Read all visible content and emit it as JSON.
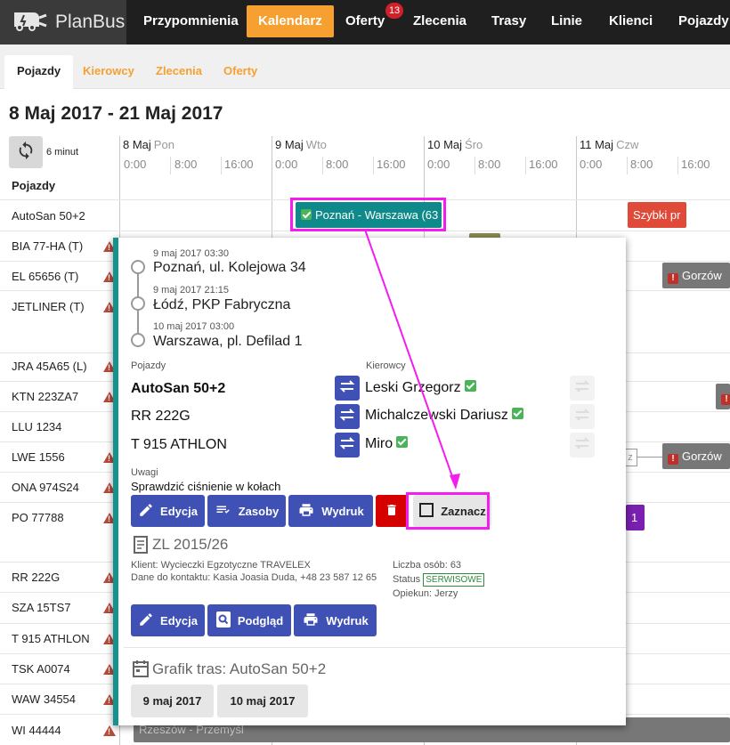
{
  "app": {
    "logo_text": "PlanBus"
  },
  "nav": {
    "items": [
      {
        "label": "Przypomnienia"
      },
      {
        "label": "Kalendarz"
      },
      {
        "label": "Oferty",
        "badge": "13"
      },
      {
        "label": "Zlecenia"
      },
      {
        "label": "Trasy"
      },
      {
        "label": "Linie"
      },
      {
        "label": "Klienci"
      },
      {
        "label": "Pojazdy"
      }
    ]
  },
  "subtabs": [
    {
      "label": "Pojazdy"
    },
    {
      "label": "Kierowcy"
    },
    {
      "label": "Zlecenia"
    },
    {
      "label": "Oferty"
    }
  ],
  "range_title": "8 Maj 2017 - 21 Maj 2017",
  "refresh_label": "6 minut",
  "days": [
    {
      "date": "8 Maj",
      "dow": "Pon"
    },
    {
      "date": "9 Maj",
      "dow": "Wto"
    },
    {
      "date": "10 Maj",
      "dow": "Śro"
    },
    {
      "date": "11 Maj",
      "dow": "Czw"
    }
  ],
  "hours": [
    "0:00",
    "8:00",
    "16:00"
  ],
  "vehicles_header": "Pojazdy",
  "rows": [
    {
      "name": "AutoSan 50+2"
    },
    {
      "name": "BIA 77-HA (T)"
    },
    {
      "name": "EL 65656 (T)"
    },
    {
      "name": "JETLINER (T)"
    },
    {
      "name": "JRA 45A65 (L)"
    },
    {
      "name": "KTN 223ZA7"
    },
    {
      "name": "LLU 1234"
    },
    {
      "name": "LWE 1556"
    },
    {
      "name": "ONA 974S24"
    },
    {
      "name": "PO 77788"
    },
    {
      "name": "RR 222G"
    },
    {
      "name": "SZA 15TS7"
    },
    {
      "name": "T 915 ATHLON"
    },
    {
      "name": "TSK A0074"
    },
    {
      "name": "WAW 34554"
    },
    {
      "name": "WI 44444"
    }
  ],
  "events": {
    "poznan": "Poznań - Warszawa (63",
    "szybki": "Szybki pr",
    "gorzow": "Gorzów",
    "one": "1",
    "z": "z",
    "rzeszow": "Rzeszów - Przemyśl"
  },
  "popup": {
    "stops": [
      {
        "date": "9 maj 2017 03:30",
        "name": "Poznań, ul. Kolejowa 34"
      },
      {
        "date": "9 maj 2017 21:15",
        "name": "Łódź, PKP Fabryczna"
      },
      {
        "date": "10 maj 2017 03:00",
        "name": "Warszawa, pl. Defilad 1"
      }
    ],
    "vehicles_label": "Pojazdy",
    "drivers_label": "Kierowcy",
    "vehicles": [
      "AutoSan 50+2",
      "RR 222G",
      "T 915 ATHLON"
    ],
    "drivers": [
      "Leski Grzegorz",
      "Michalczewski Dariusz",
      "Miro"
    ],
    "notes_label": "Uwagi",
    "notes_text": "Sprawdzić ciśnienie w kołach",
    "buttons": {
      "edit": "Edycja",
      "resources": "Zasoby",
      "print": "Wydruk",
      "mark": "Zaznacz"
    },
    "order": {
      "title": "ZL 2015/26",
      "client": "Klient: Wycieczki Egzotyczne TRAVELEX",
      "contact": "Dane do kontaktu: Kasia Joasia Duda, +48 23 587 12 65",
      "people": "Liczba osób: 63",
      "status_label": "Status",
      "status_value": "SERWISOWE",
      "guardian": "Opiekun: Jerzy",
      "btn_edit": "Edycja",
      "btn_preview": "Podgląd",
      "btn_print": "Wydruk"
    },
    "schedule": {
      "title": "Grafik tras: AutoSan 50+2",
      "dates": [
        "9 maj 2017",
        "10 maj 2017"
      ]
    }
  },
  "colors": {
    "accent": "#f5a030",
    "primary": "#3f51b5",
    "event_teal": "#0f8a8a",
    "highlight": "#f51cf0",
    "danger": "#d50000"
  }
}
